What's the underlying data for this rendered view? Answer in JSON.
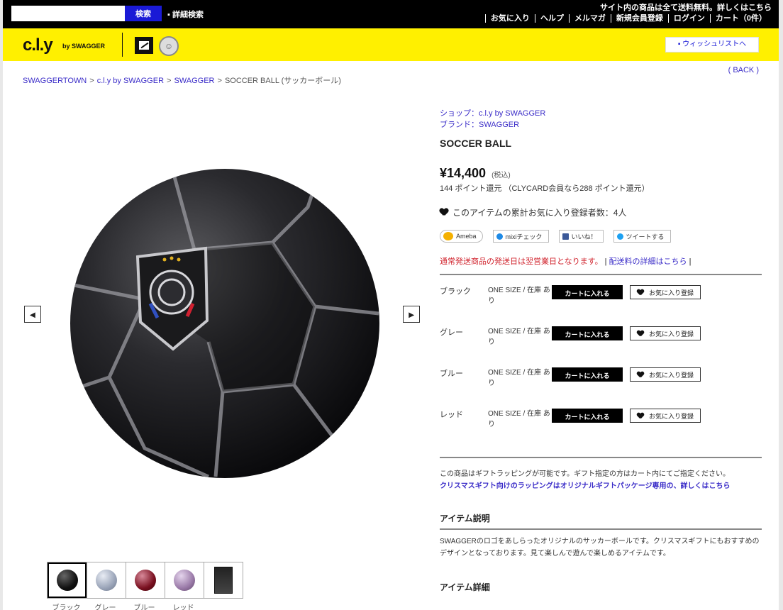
{
  "topbar": {
    "search_placeholder": "",
    "search_button": "検索",
    "advanced_search": "▪ 詳細検索",
    "notice": "サイト内の商品は全て送料無料。詳しくはこちら",
    "nav": [
      "お気に入り",
      "ヘルプ",
      "メルマガ",
      "新規会員登録",
      "ログイン",
      "カート（0件）"
    ]
  },
  "header": {
    "logo": "c.l.y",
    "logo_sub": "by SWAGGER",
    "circle_icon_glyph": "☺",
    "wishlist_button": "▪ ウィッシュリストへ"
  },
  "breadcrumb": {
    "items": [
      "SWAGGERTOWN",
      "c.l.y by SWAGGER",
      "SWAGGER",
      "SOCCER BALL (サッカーボール)"
    ],
    "back": "( BACK )"
  },
  "gallery": {
    "prev": "◂",
    "next": "▸",
    "thumb_labels": [
      "ブラック",
      "グレー",
      "ブルー",
      "レッド",
      ""
    ]
  },
  "product": {
    "shop_label": "ショップ：",
    "shop_value": "c.l.y by SWAGGER",
    "brand_label": "ブランド：",
    "brand_value": "SWAGGER",
    "name": "SOCCER BALL",
    "price": "¥14,400",
    "tax": "(税込)",
    "points": "144 ポイント還元 （CLYCARD会員なら288 ポイント還元）",
    "favorites": "このアイテムの累計お気に入り登録者数：4人",
    "share": [
      {
        "label": "Ameba",
        "color": "#f4b000"
      },
      {
        "label": "mixiチェック",
        "color": "#1e8ae6"
      },
      {
        "label": "いいね！",
        "color": "#3b5998"
      },
      {
        "label": "ツイートする",
        "color": "#1da1f2"
      }
    ],
    "notice_red": "通常発送商品の発送日は翌営業日となります。",
    "notice_blue": "配送料の詳細はこちら"
  },
  "variants": [
    {
      "color": "ブラック",
      "stock": "ONE SIZE / 在庫 あり",
      "cart": "カートに入れる",
      "fav": "お気に入り登録"
    },
    {
      "color": "グレー",
      "stock": "ONE SIZE / 在庫 あり",
      "cart": "カートに入れる",
      "fav": "お気に入り登録"
    },
    {
      "color": "ブルー",
      "stock": "ONE SIZE / 在庫 あり",
      "cart": "カートに入れる",
      "fav": "お気に入り登録"
    },
    {
      "color": "レッド",
      "stock": "ONE SIZE / 在庫 あり",
      "cart": "カートに入れる",
      "fav": "お気に入り登録"
    }
  ],
  "shipping": {
    "text": "この商品はギフトラッピングが可能です。ギフト指定の方はカート内にてご指定ください。",
    "link": "クリスマスギフト向けのラッピングはオリジナルギフトパッケージ専用の、詳しくはこちら"
  },
  "description": {
    "title": "アイテム説明",
    "text": "SWAGGERのロゴをあしらったオリジナルのサッカーボールです。クリスマスギフトにもおすすめのデザインとなっております。見て楽しんで遊んで楽しめるアイテムです。"
  },
  "spec": {
    "title": "アイテム詳細"
  }
}
